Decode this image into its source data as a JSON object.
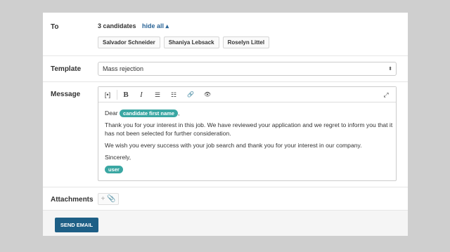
{
  "to": {
    "label": "To",
    "count_text": "3 candidates",
    "hide_all_label": "hide all ▴",
    "recipients": [
      "Salvador Schneider",
      "Shaniya Lebsack",
      "Roselyn Littel"
    ]
  },
  "template": {
    "label": "Template",
    "selected": "Mass rejection",
    "arrow_icon": "⬍"
  },
  "message": {
    "label": "Message",
    "toolbar": {
      "placeholder_icon": "[•]",
      "bold": "B",
      "italic": "I",
      "bullet_list_icon": "☰",
      "numbered_list_icon": "☷",
      "link_icon": "🔗",
      "preview_icon": "👁",
      "expand_icon": "⤢"
    },
    "greeting": "Dear",
    "greeting_token": "candidate first name",
    "greeting_suffix": ",",
    "paragraph1": "Thank you for your interest in this job. We have reviewed your application and we regret to inform you that it has not been selected for further consideration.",
    "paragraph2": "We wish you every success with your job search and thank you for your interest in our company.",
    "closing": "Sincerely,",
    "signature_token": "user"
  },
  "attachments": {
    "label": "Attachments",
    "add_icon": "+ 📎"
  },
  "footer": {
    "send_label": "SEND EMAIL"
  },
  "colors": {
    "accent_link": "#2a6496",
    "token_pill": "#3aa7a3",
    "send_button": "#1e5f86"
  }
}
